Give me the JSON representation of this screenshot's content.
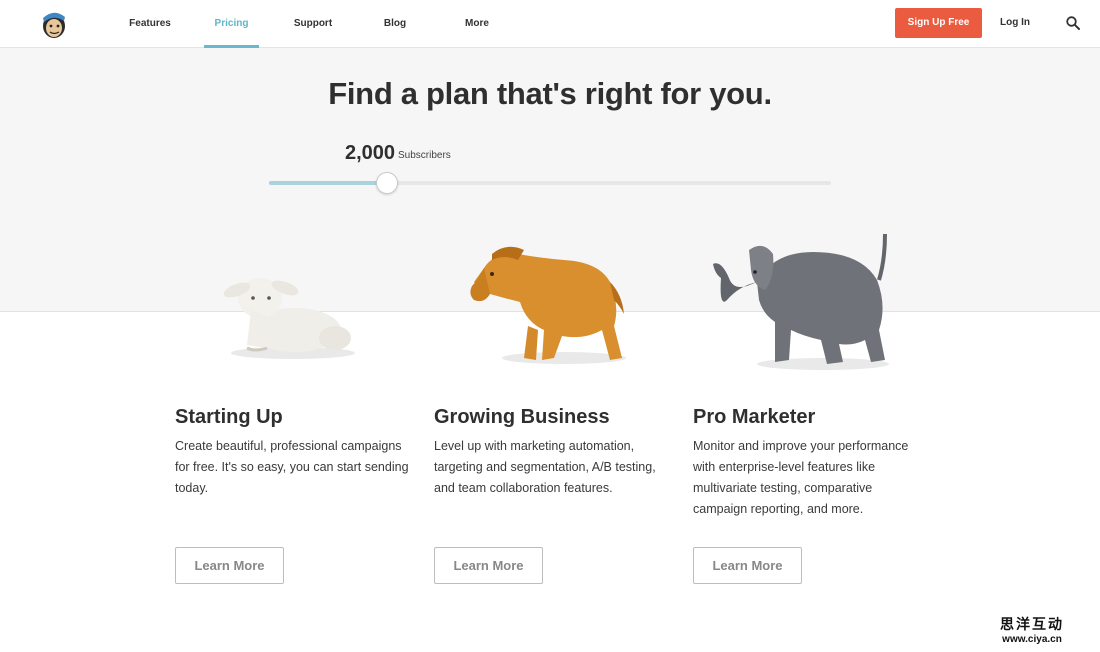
{
  "header": {
    "nav": [
      {
        "label": "Features",
        "active": false
      },
      {
        "label": "Pricing",
        "active": true
      },
      {
        "label": "Support",
        "active": false
      },
      {
        "label": "Blog",
        "active": false
      },
      {
        "label": "More",
        "active": false
      }
    ],
    "signup_label": "Sign Up Free",
    "login_label": "Log In",
    "search_icon": "search-icon",
    "logo_icon": "chimp-logo-icon"
  },
  "hero": {
    "title": "Find a plan that's right for you.",
    "subscriber_count": "2,000",
    "subscriber_label": "Subscribers",
    "slider_fraction": 0.21
  },
  "plans": [
    {
      "title": "Starting Up",
      "description": "Create beautiful, professional campaigns for free. It's so easy, you can start sending today.",
      "button_label": "Learn More",
      "image_icon": "lamb-figurine-image"
    },
    {
      "title": "Growing Business",
      "description": "Level up with marketing automation, targeting and segmentation, A/B testing, and team collaboration features.",
      "button_label": "Learn More",
      "image_icon": "horse-figurine-image"
    },
    {
      "title": "Pro Marketer",
      "description": "Monitor and improve your performance with enterprise-level features like multivariate testing, comparative campaign reporting, and more.",
      "button_label": "Learn More",
      "image_icon": "elephant-figurine-image"
    }
  ],
  "watermark": {
    "line1": "思洋互动",
    "line2": "www.ciya.cn"
  },
  "colors": {
    "accent": "#6ab8cd",
    "signup": "#ea5b3f",
    "hero_bg": "#f6f6f6"
  }
}
